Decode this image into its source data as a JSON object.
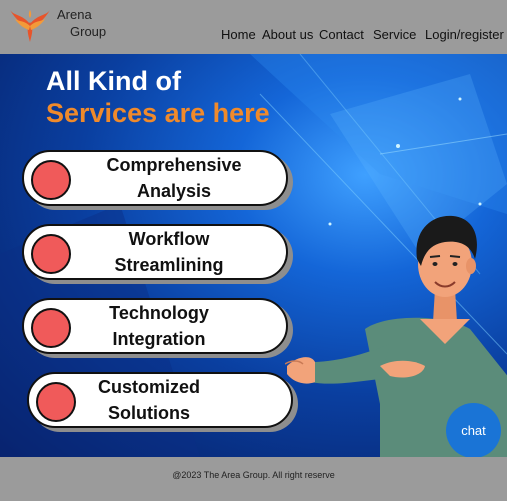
{
  "header": {
    "brand_line1": "Arena",
    "brand_line2": "Group",
    "nav": [
      "Home",
      "About us",
      "Contact",
      "Service",
      "Login/register"
    ]
  },
  "hero": {
    "title_line1": "All Kind of",
    "title_line2": "Services are here",
    "services": [
      {
        "line1": "Comprehensive",
        "line2": "Analysis"
      },
      {
        "line1": "Workflow",
        "line2": "Streamlining"
      },
      {
        "line1": "Technology",
        "line2": "Integration"
      },
      {
        "line1": "Customized",
        "line2": "Solutions"
      }
    ]
  },
  "chat_label": "chat",
  "footer": {
    "text": "@2023 The Area Group. All right reserve"
  },
  "colors": {
    "accent_orange": "#f08a2b",
    "dot_red": "#f05a5a",
    "chat_blue": "#1a74d6"
  }
}
